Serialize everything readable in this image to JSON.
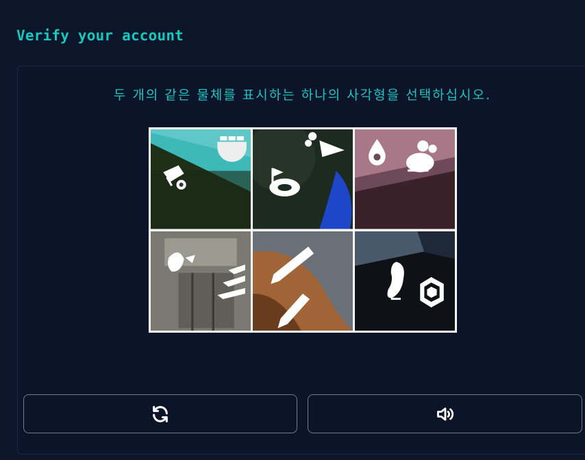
{
  "page": {
    "title": "Verify your account"
  },
  "captcha": {
    "instruction": "두 개의 같은 물체를 표시하는 하나의 사각형을 선택하십시오.",
    "tiles": [
      {
        "icons": [
          "wheelbarrow-icon",
          "brick-wall-icon"
        ]
      },
      {
        "icons": [
          "carrot-icon",
          "golf-hole-icon"
        ]
      },
      {
        "icons": [
          "water-drop-icon",
          "mouse-icon"
        ]
      },
      {
        "icons": [
          "bird-icon",
          "stairs-icon"
        ]
      },
      {
        "icons": [
          "pencil-icon",
          "pencil-icon"
        ]
      },
      {
        "icons": [
          "foot-icon",
          "gem-icon"
        ]
      }
    ]
  },
  "controls": {
    "refresh_icon": "refresh-icon",
    "audio_icon": "speaker-icon"
  },
  "colors": {
    "background": "#0c162b",
    "accent": "#18c8bd",
    "button_border": "#6f7b93"
  }
}
